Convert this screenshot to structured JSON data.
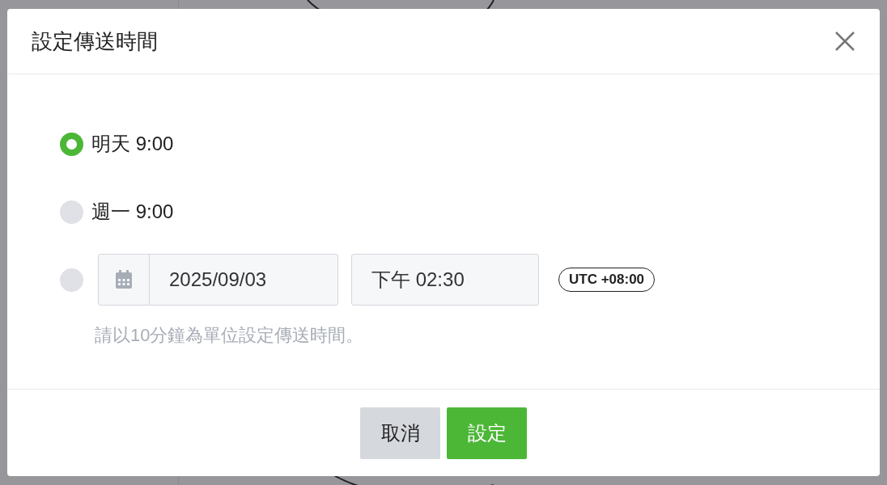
{
  "dialog": {
    "title": "設定傳送時間"
  },
  "options": [
    {
      "kind": "preset",
      "label": "明天 9:00",
      "selected": true
    },
    {
      "kind": "preset",
      "label": "週一 9:00",
      "selected": false
    },
    {
      "kind": "custom",
      "selected": false,
      "date": "2025/09/03",
      "time": "下午 02:30",
      "timezone": "UTC +08:00",
      "hint": "請以10分鐘為單位設定傳送時間。"
    }
  ],
  "buttons": [
    {
      "kind": "secondary",
      "label": "取消"
    },
    {
      "kind": "primary",
      "label": "設定"
    }
  ]
}
